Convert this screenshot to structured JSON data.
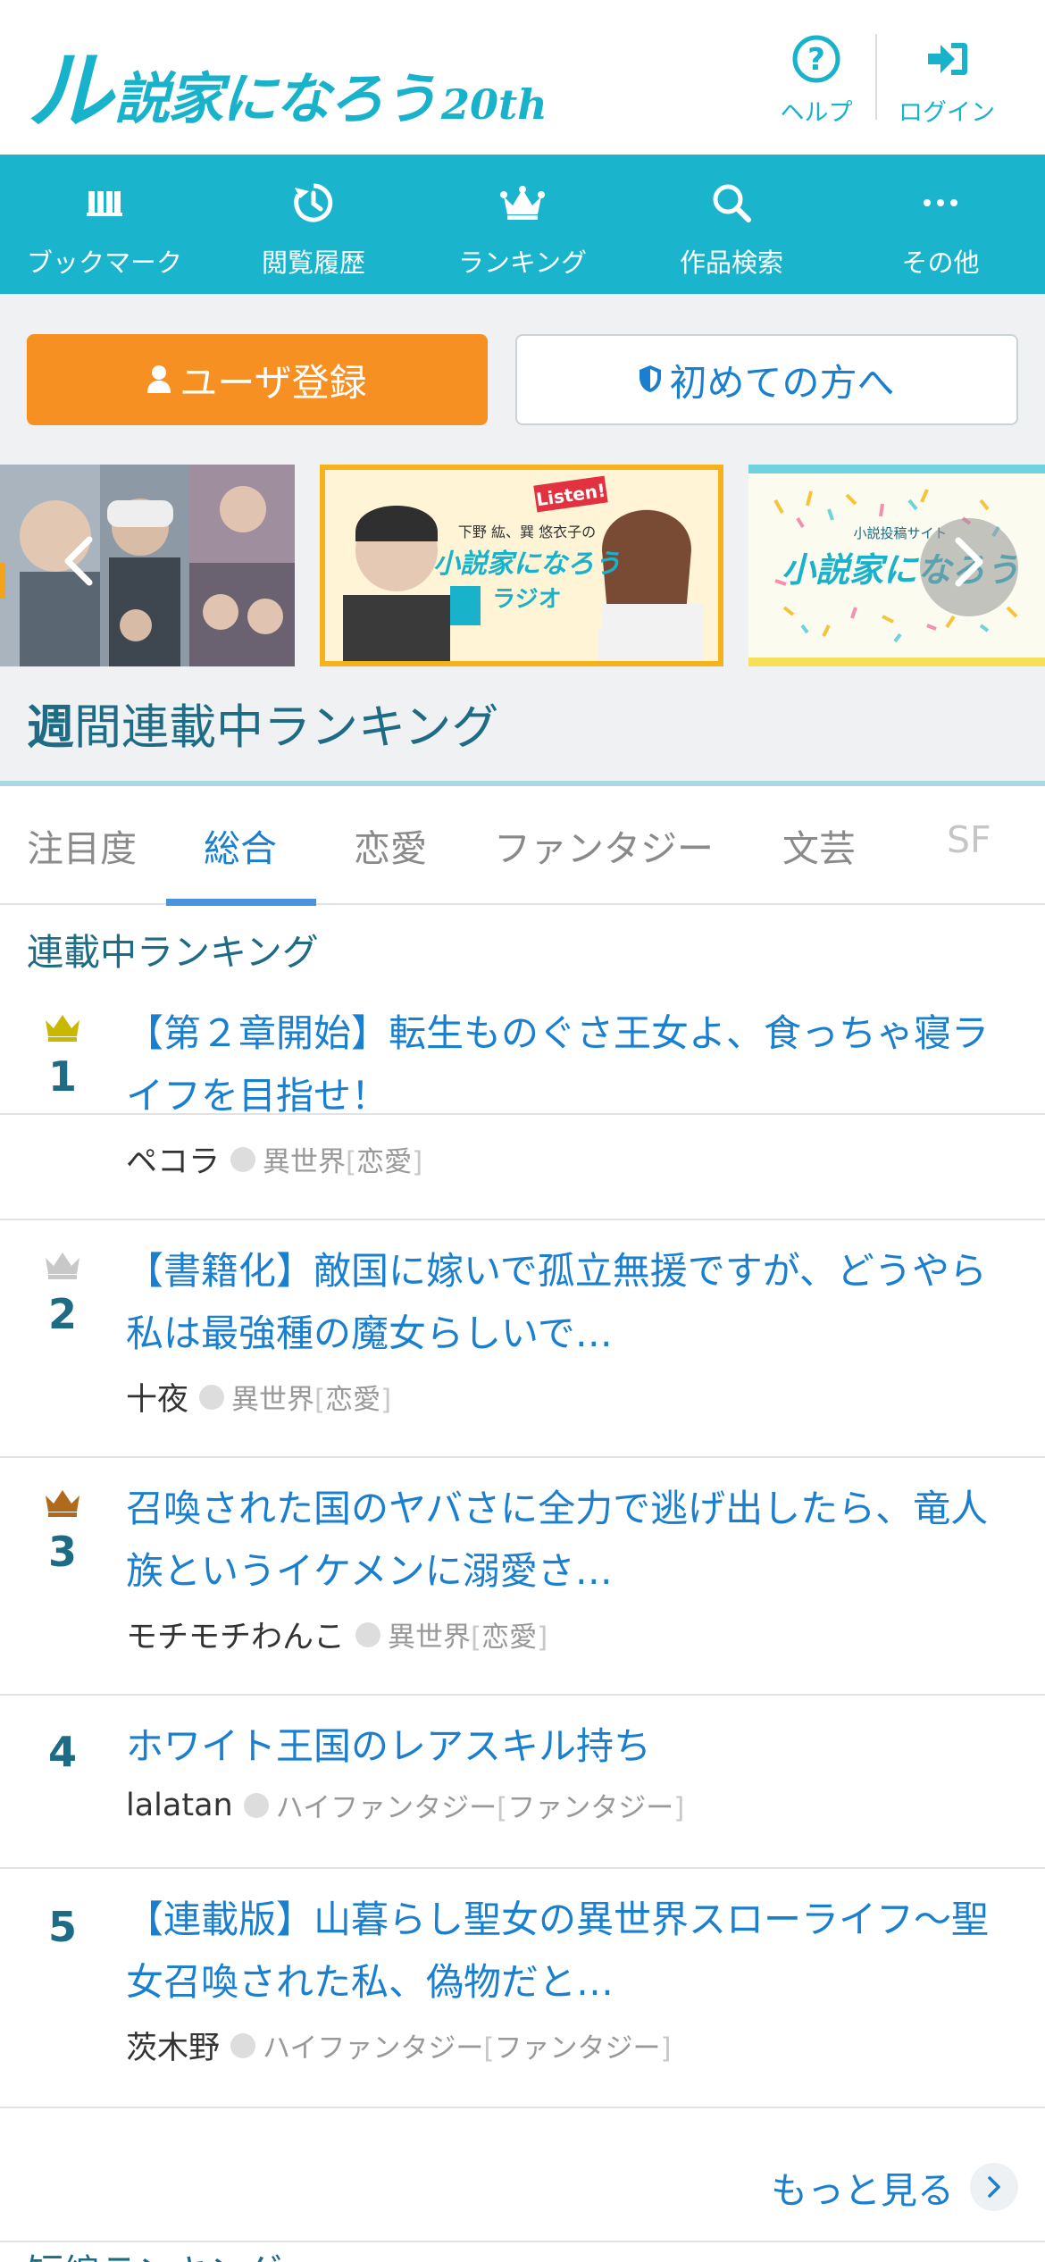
{
  "header": {
    "logo_mark": "ル",
    "logo_text": "説家になろう",
    "logo_anniversary": "20th",
    "help_label": "ヘルプ",
    "login_label": "ログイン"
  },
  "nav": {
    "items": [
      {
        "label": "ブックマーク",
        "icon": "books-icon"
      },
      {
        "label": "閲覧履歴",
        "icon": "history-icon"
      },
      {
        "label": "ランキング",
        "icon": "crown-icon"
      },
      {
        "label": "作品検索",
        "icon": "search-icon"
      },
      {
        "label": "その他",
        "icon": "more-icon"
      }
    ]
  },
  "cta": {
    "register_label": "ユーザ登録",
    "first_time_label": "初めての方へ"
  },
  "banners": {
    "radio_badge": "Listen!",
    "radio_caption": "下野 紘、巽 悠衣子の",
    "radio_title": "小説家になろう",
    "radio_sub": "ラジオ",
    "site_caption": "小説投稿サイト",
    "site_title": "小説家になろう"
  },
  "section": {
    "title_bold": "週",
    "title_rest": "間連載中ランキング"
  },
  "tabs": [
    {
      "label": "注目度"
    },
    {
      "label": "総合"
    },
    {
      "label": "恋愛"
    },
    {
      "label": "ファンタジー"
    },
    {
      "label": "文芸"
    },
    {
      "label": "SF"
    }
  ],
  "list_heading": "連載中ランキング",
  "rankings": [
    {
      "rank": "1",
      "title": "【第２章開始】転生ものぐさ王女よ、食っちゃ寝ライフを目指せ！",
      "author": "ペコラ",
      "genre": "異世界",
      "category": "恋愛",
      "crown_color": "#c9b800"
    },
    {
      "rank": "2",
      "title": "【書籍化】敵国に嫁いで孤立無援ですが、どうやら私は最強種の魔女らしいで…",
      "author": "十夜",
      "genre": "異世界",
      "category": "恋愛",
      "crown_color": "#c8c8c8"
    },
    {
      "rank": "3",
      "title": "召喚された国のヤバさに全力で逃げ出したら、竜人族というイケメンに溺愛さ…",
      "author": "モチモチわんこ",
      "genre": "異世界",
      "category": "恋愛",
      "crown_color": "#b06a1c"
    },
    {
      "rank": "4",
      "title": "ホワイト王国のレアスキル持ち",
      "author": "lalatan",
      "genre": "ハイファンタジー",
      "category": "ファンタジー",
      "crown_color": ""
    },
    {
      "rank": "5",
      "title": "【連載版】山暮らし聖女の異世界スローライフ〜聖女召喚された私、偽物だと…",
      "author": "茨木野",
      "genre": "ハイファンタジー",
      "category": "ファンタジー",
      "crown_color": ""
    }
  ],
  "more_label": "もっと見る",
  "next_heading": "短編ランキング",
  "colors": {
    "brand": "#1ab5cd",
    "register": "#f79023",
    "link": "#1a7fcf",
    "rank_text": "#1d6b84"
  }
}
